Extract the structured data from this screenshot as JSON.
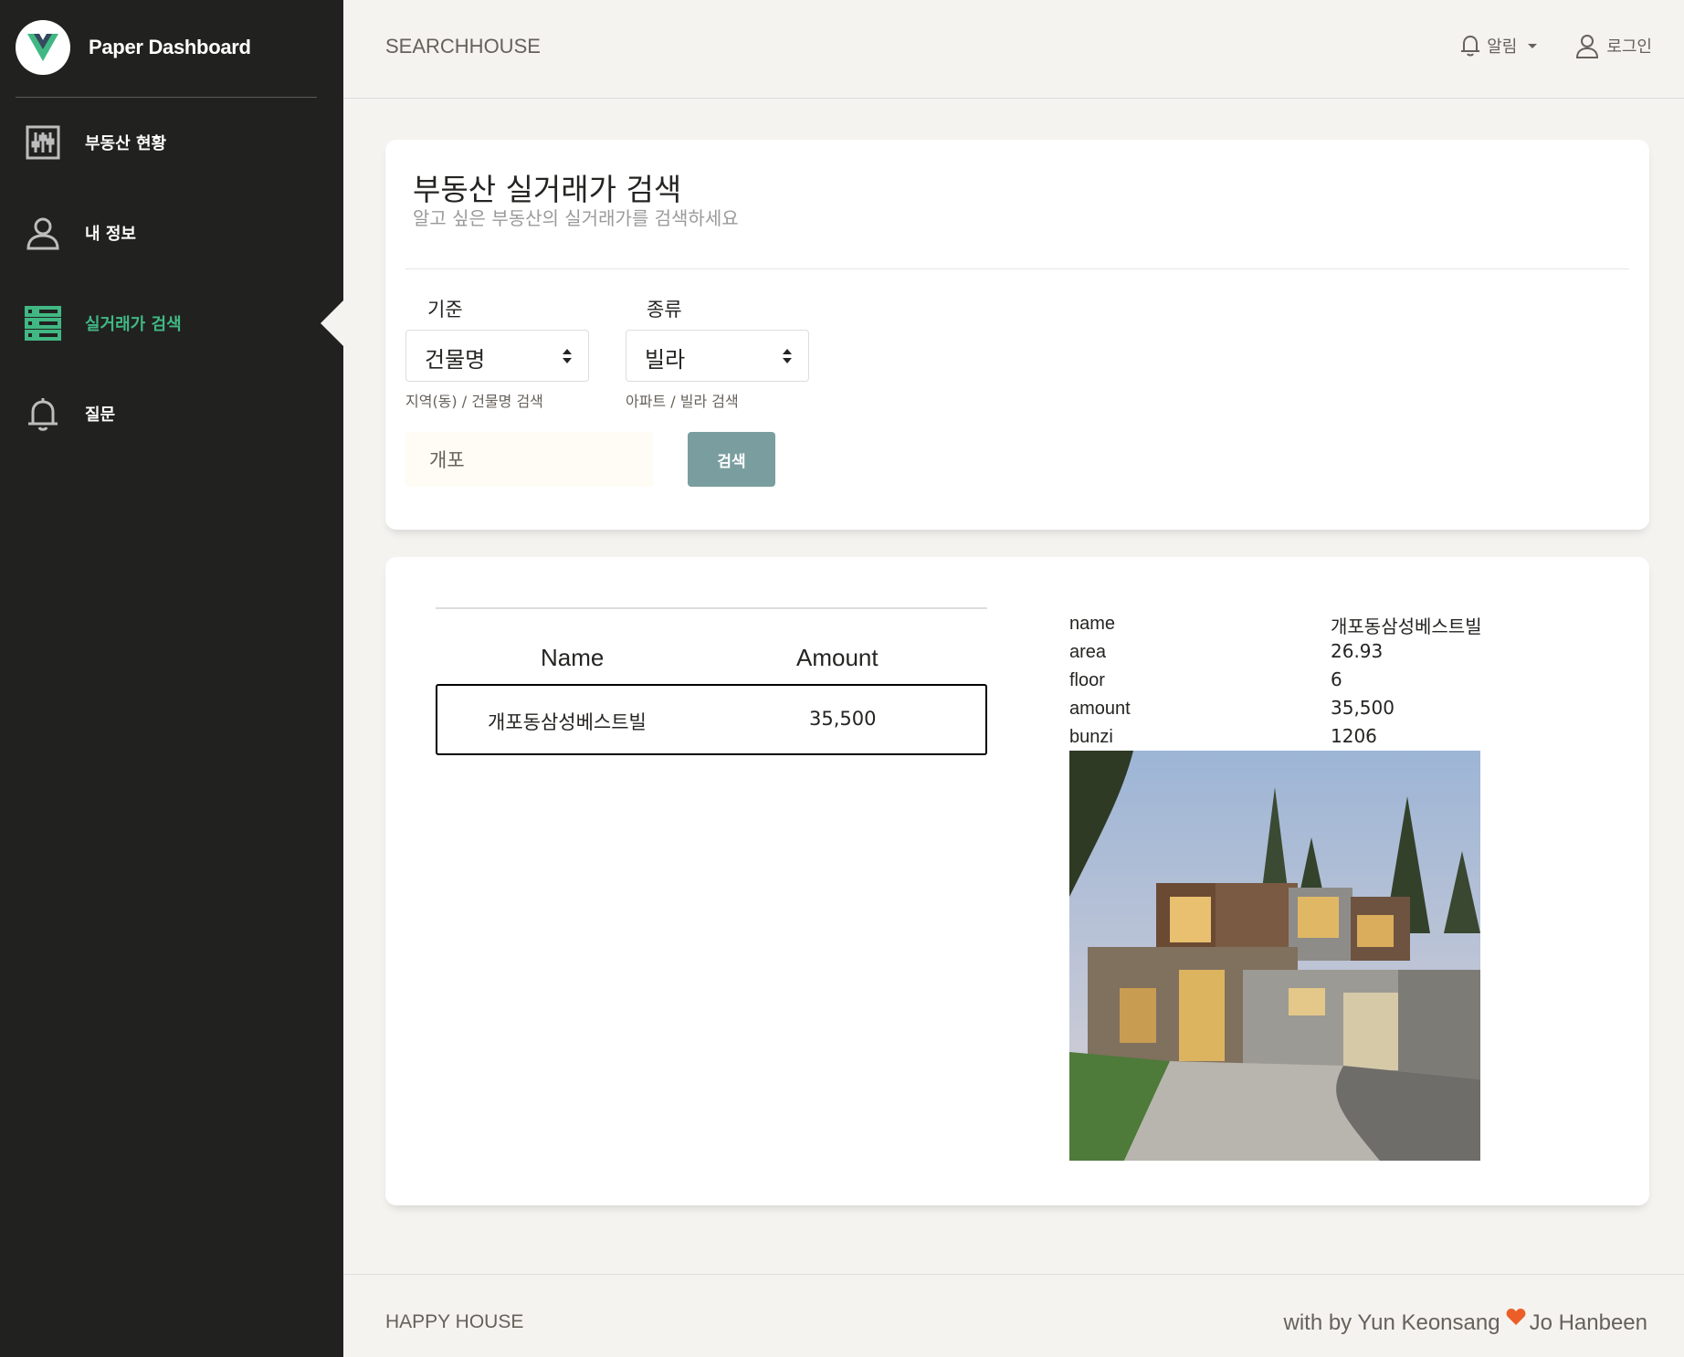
{
  "brand": {
    "name": "Paper Dashboard"
  },
  "sidebar": {
    "items": [
      {
        "label": "부동산 현황",
        "icon": "equalizer-icon",
        "active": false
      },
      {
        "label": "내 정보",
        "icon": "user-icon",
        "active": false
      },
      {
        "label": "실거래가 검색",
        "icon": "view-list-icon",
        "active": true
      },
      {
        "label": "질문",
        "icon": "bell-icon",
        "active": false
      }
    ]
  },
  "topbar": {
    "title": "SEARCHHOUSE",
    "notifications_label": "알림",
    "login_label": "로그인"
  },
  "search": {
    "title": "부동산 실거래가 검색",
    "subtitle": "알고 싶은 부동산의 실거래가를 검색하세요",
    "criteria": {
      "label": "기준",
      "value": "건물명",
      "help": "지역(동) / 건물명 검색"
    },
    "type": {
      "label": "종류",
      "value": "빌라",
      "help": "아파트 / 빌라 검색"
    },
    "query": {
      "value": "개포",
      "placeholder": ""
    },
    "button_label": "검색"
  },
  "results": {
    "columns": [
      "Name",
      "Amount"
    ],
    "rows": [
      {
        "name": "개포동삼성베스트빌",
        "amount": "35,500"
      }
    ]
  },
  "detail": {
    "fields": [
      {
        "key": "name",
        "value": "개포동삼성베스트빌"
      },
      {
        "key": "area",
        "value": "26.93"
      },
      {
        "key": "floor",
        "value": "6"
      },
      {
        "key": "amount",
        "value": "35,500"
      },
      {
        "key": "bunzi",
        "value": "1206"
      }
    ],
    "image": "house-photo"
  },
  "footer": {
    "left": "HAPPY HOUSE",
    "right_prefix": "with by Yun Keonsang",
    "right_suffix": "Jo Hanbeen"
  },
  "colors": {
    "sidebar_bg": "#212120",
    "accent_green": "#41b883",
    "button": "#7a9e9f",
    "heart": "#eb5e28",
    "page_bg": "#f4f3ef"
  }
}
